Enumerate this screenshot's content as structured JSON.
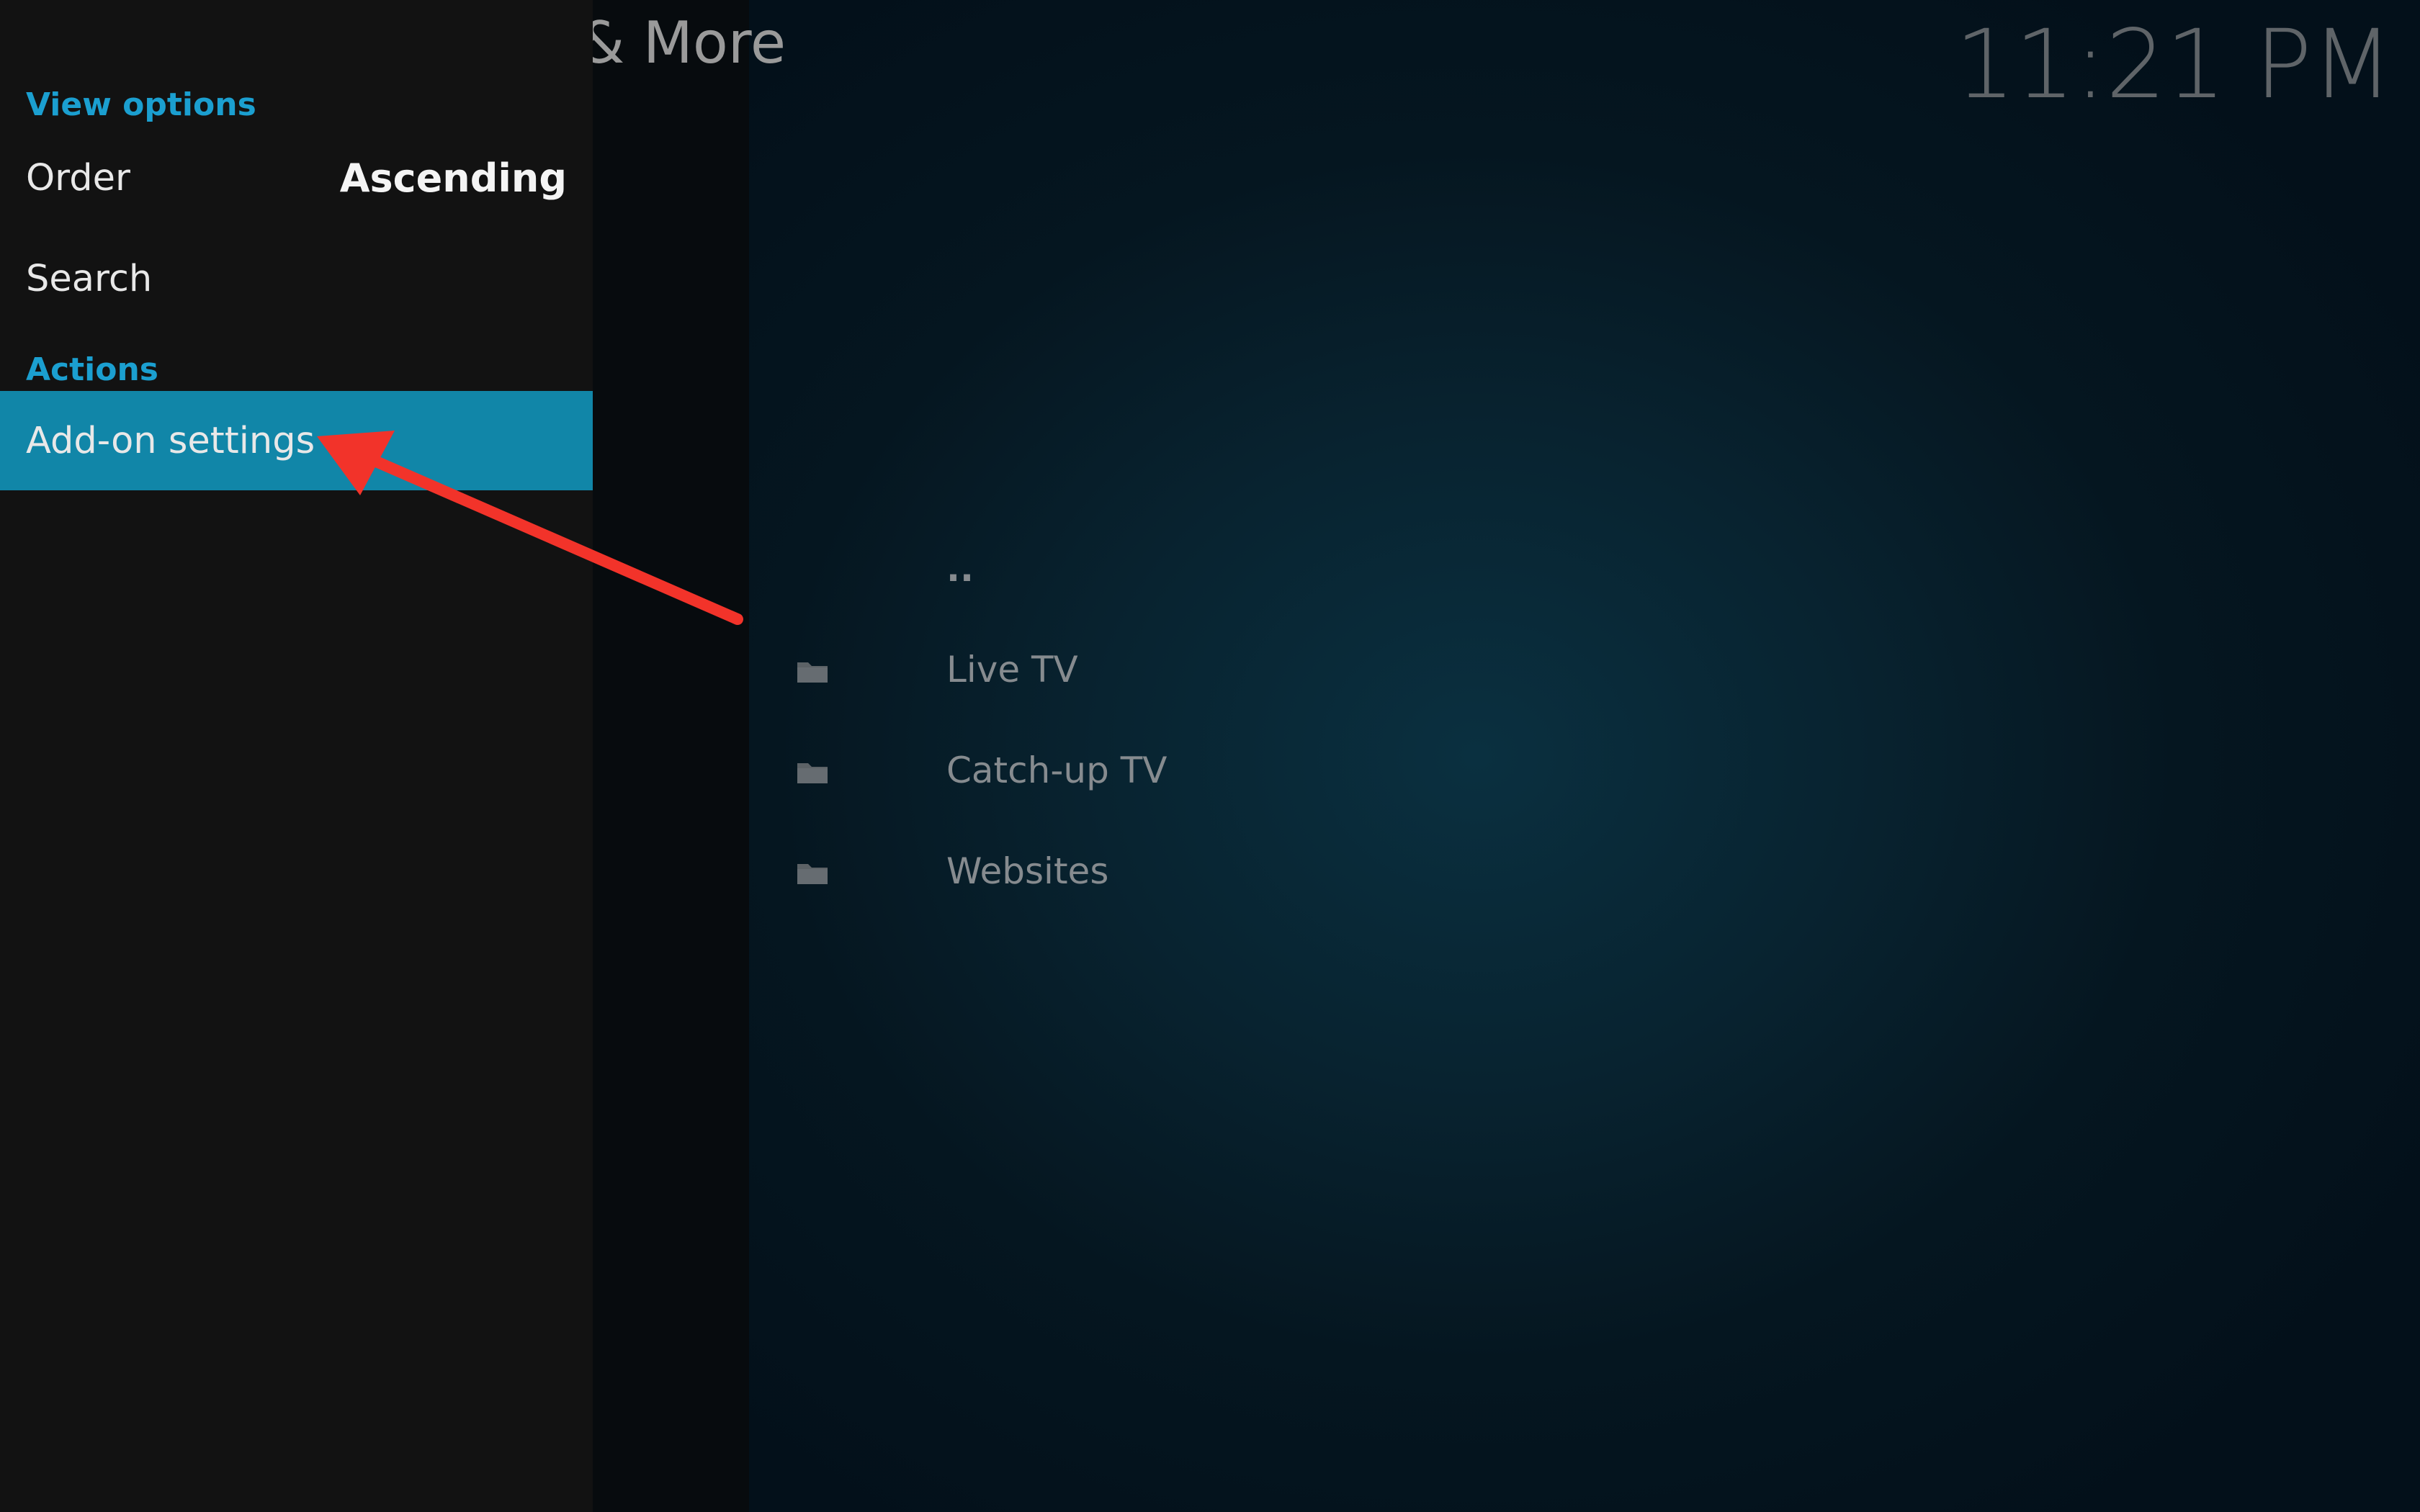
{
  "header": {
    "title": "& More",
    "clock": "11:21 PM"
  },
  "side_menu": {
    "sections": [
      {
        "label": "View options",
        "items": [
          {
            "label": "Order",
            "value": "Ascending"
          },
          {
            "label": "Search",
            "value": ""
          }
        ]
      },
      {
        "label": "Actions",
        "items": [
          {
            "label": "Add-on settings",
            "value": "",
            "selected": true
          }
        ]
      }
    ]
  },
  "file_list": {
    "items": [
      {
        "label": "..",
        "icon": "none"
      },
      {
        "label": "Live TV",
        "icon": "folder-icon"
      },
      {
        "label": "Catch-up TV",
        "icon": "folder-icon"
      },
      {
        "label": "Websites",
        "icon": "folder-icon"
      }
    ]
  },
  "annotation": {
    "arrow_color": "#f2332a"
  },
  "colors": {
    "accent": "#1b9fd0",
    "selected_row": "#1186a8",
    "panel_bg": "#121212"
  }
}
